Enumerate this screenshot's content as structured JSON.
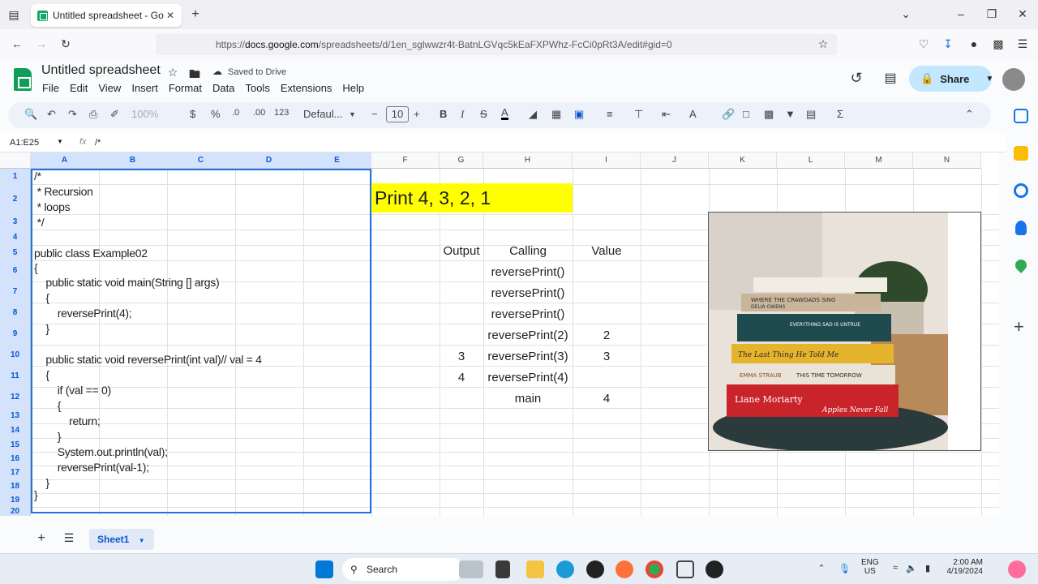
{
  "browser": {
    "tab_title": "Untitled spreadsheet - Google S",
    "url_prefix": "https://",
    "url_host": "docs.google.com",
    "url_path": "/spreadsheets/d/1en_sglwwzr4t-BatnLGVqc5kEaFXPWhz-FcCi0pRt3A/edit#gid=0"
  },
  "doc": {
    "title": "Untitled spreadsheet",
    "saved_status": "Saved to Drive",
    "share_label": "Share",
    "menu": [
      "File",
      "Edit",
      "View",
      "Insert",
      "Format",
      "Data",
      "Tools",
      "Extensions",
      "Help"
    ]
  },
  "toolbar": {
    "zoom": "100%",
    "currency": "$",
    "percent": "%",
    "dec_decrease": ".0",
    "dec_increase": ".00",
    "number_format": "123",
    "font": "Defaul...",
    "font_size": "10",
    "bold": "B",
    "italic": "I"
  },
  "formula_bar": {
    "name_box": "A1:E25",
    "fx": "fx",
    "content": "/*"
  },
  "columns": [
    "A",
    "B",
    "C",
    "D",
    "E",
    "F",
    "G",
    "H",
    "I",
    "J",
    "K",
    "L",
    "M",
    "N"
  ],
  "rows": [
    "1",
    "2",
    "3",
    "4",
    "5",
    "6",
    "7",
    "8",
    "9",
    "10",
    "11",
    "12",
    "13",
    "14",
    "15",
    "16",
    "17",
    "18",
    "19",
    "20"
  ],
  "code_lines": [
    "/*",
    " * Recursion",
    " * loops",
    " */",
    "",
    "public class Example02",
    "{",
    "    public static void main(String [] args)",
    "    {",
    "        reversePrint(4);",
    "    }",
    "",
    "    public static void reversePrint(int val)// val = 4",
    "    {",
    "        if (val == 0)",
    "        {",
    "            return;",
    "        }",
    "        System.out.println(val);",
    "        reversePrint(val-1);",
    "    }",
    "}"
  ],
  "banner_text": "Print 4, 3, 2, 1",
  "trace_table": {
    "headers": [
      "Output",
      "Calling",
      "Value"
    ],
    "rows": [
      [
        "",
        "reversePrint()",
        ""
      ],
      [
        "",
        "reversePrint()",
        ""
      ],
      [
        "",
        "reversePrint()",
        ""
      ],
      [
        "",
        "reversePrint(2)",
        "2"
      ],
      [
        "3",
        "reversePrint(3)",
        "3"
      ],
      [
        "4",
        "reversePrint(4)",
        ""
      ],
      [
        "",
        "main",
        "4"
      ]
    ]
  },
  "image_book_titles": [
    "WHERE THE CRAWDADS SING",
    "DELIA OWENS",
    "EVERYTHING SAD IS UNTRUE",
    "The Last Thing He Told Me",
    "EMMA STRAUB",
    "THIS TIME TOMORROW",
    "Liane Moriarty",
    "Apples Never Fall"
  ],
  "sheet_tab": "Sheet1",
  "taskbar": {
    "search": "Search",
    "lang": "ENG",
    "region": "US",
    "time": "2:00 AM",
    "date": "4/19/2024"
  }
}
